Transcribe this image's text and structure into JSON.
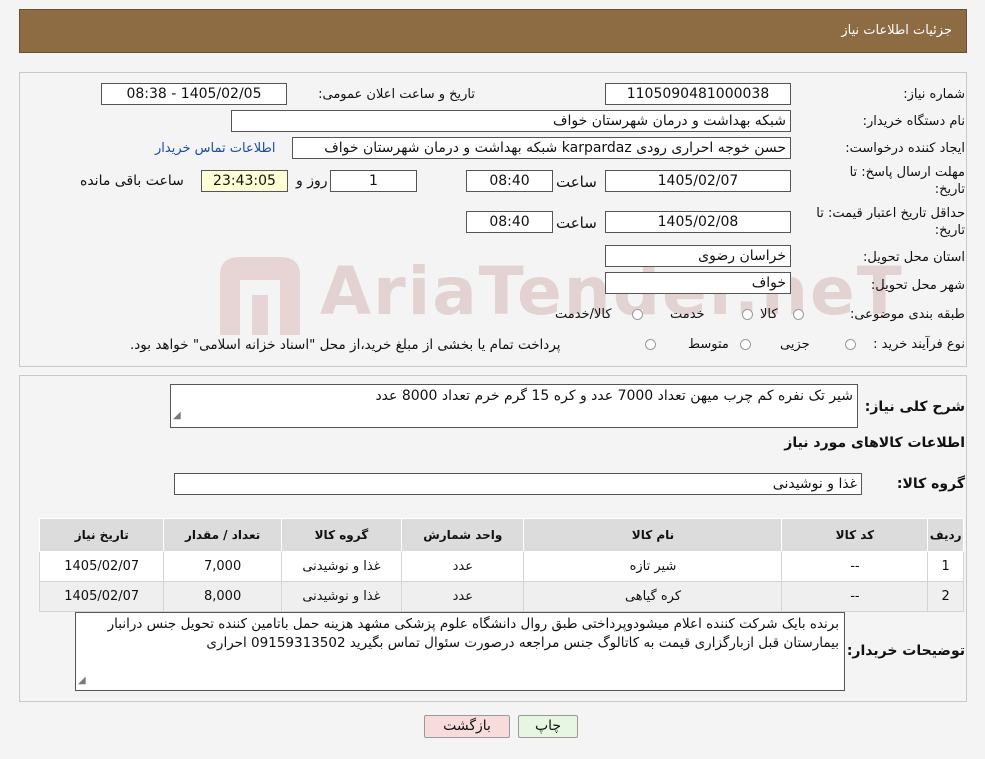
{
  "header": {
    "title": "جزئیات اطلاعات نیاز"
  },
  "form": {
    "need_number_label": "شماره نیاز:",
    "need_number": "1105090481000038",
    "announce_label": "تاریخ و ساعت اعلان عمومی:",
    "announce_value": "1405/02/05 - 08:38",
    "buyer_org_label": "نام دستگاه خریدار:",
    "buyer_org": "شبکه بهداشت و درمان شهرستان خواف",
    "creator_label": "ایجاد کننده درخواست:",
    "creator": "حسن خوجه احراری رودی karpardaz شبکه بهداشت و درمان شهرستان خواف",
    "contact_link": "اطلاعات تماس خریدار",
    "deadline_label": "مهلت ارسال پاسخ: تا تاریخ:",
    "deadline_date": "1405/02/07",
    "time_word": "ساعت",
    "deadline_time": "08:40",
    "days_value": "1",
    "days_word": "روز و",
    "remaining_time": "23:43:05",
    "remaining_word": "ساعت باقی مانده",
    "validity_label": "حداقل تاریخ اعتبار قیمت: تا تاریخ:",
    "validity_date": "1405/02/08",
    "validity_time": "08:40",
    "province_label": "استان محل تحویل:",
    "province": "خراسان رضوی",
    "city_label": "شهر محل تحویل:",
    "city": "خواف",
    "category_label": "طبقه بندی موضوعی:",
    "category_options": [
      "کالا",
      "خدمت",
      "کالا/خدمت"
    ],
    "process_label": "نوع فرآیند خرید :",
    "process_options": [
      "جزیی",
      "متوسط"
    ],
    "process_note": "پرداخت تمام یا بخشی از مبلغ خرید،از محل \"اسناد خزانه اسلامی\" خواهد بود."
  },
  "description": {
    "summary_label": "شرح کلی نیاز:",
    "summary": "شیر تک نفره کم چرب میهن تعداد 7000 عدد و کره 15 گرم خرم تعداد 8000 عدد",
    "goods_info_title": "اطلاعات کالاهای مورد نیاز",
    "goods_group_label": "گروه کالا:",
    "goods_group": "غذا و نوشیدنی"
  },
  "table": {
    "headers": [
      "ردیف",
      "کد کالا",
      "نام کالا",
      "واحد شمارش",
      "گروه کالا",
      "تعداد / مقدار",
      "تاریخ نیاز"
    ],
    "rows": [
      [
        "1",
        "--",
        "شیر تازه",
        "عدد",
        "غذا و نوشیدنی",
        "7,000",
        "1405/02/07"
      ],
      [
        "2",
        "--",
        "کره گیاهی",
        "عدد",
        "غذا و نوشیدنی",
        "8,000",
        "1405/02/07"
      ]
    ]
  },
  "notes": {
    "label": "توضیحات خریدار:",
    "text": "برنده بایک شرکت کننده اعلام میشودوپرداختی طبق روال دانشگاه علوم پزشکی مشهد هزینه حمل باتامین کننده تحویل جنس درانبار بیمارستان قبل ازبارگزاری قیمت به کاتالوگ جنس مراجعه درصورت سئوال تماس بگیرید 09159313502 احراری"
  },
  "buttons": {
    "back": "بازگشت",
    "print": "چاپ"
  },
  "watermark": "AriaTender.neT",
  "colors": {
    "header": "#8d6b43",
    "link": "#1a4ba8",
    "back_button": "#f8dcdc",
    "print_button": "#e6f6e0",
    "timer_bg": "#ffffd6"
  }
}
